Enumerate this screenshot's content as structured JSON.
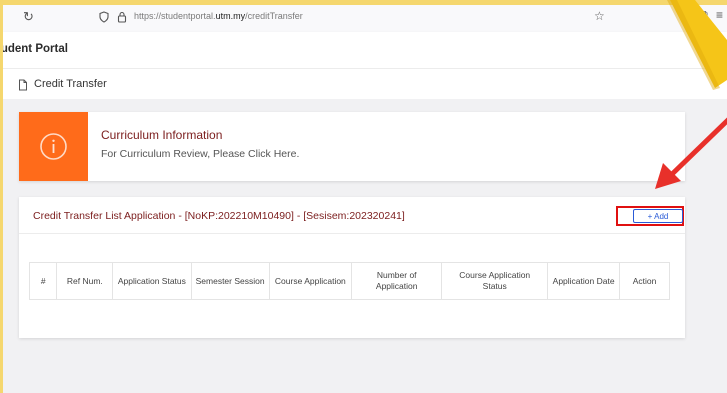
{
  "browser": {
    "url_prefix": "https://studentportal.",
    "url_host": "utm.my",
    "url_path": "/creditTransfer",
    "icons": [
      "reload-icon",
      "shield-icon",
      "lock-icon",
      "star-icon",
      "extensions-icon",
      "menu-icon"
    ]
  },
  "app": {
    "title": "tudent Portal"
  },
  "page": {
    "title": "Credit Transfer"
  },
  "info_card": {
    "title": "Curriculum Information",
    "text": "For Curriculum Review, Please Click Here."
  },
  "list": {
    "title": "Credit Transfer List Application - [NoKP:202210M10490] - [Sesisem:202320241]",
    "add_label": "+ Add",
    "columns": [
      "#",
      "Ref Num.",
      "Application Status",
      "Semester Session",
      "Course Application",
      "Number of Application",
      "Course Application Status",
      "Application Date",
      "Action"
    ],
    "rows": []
  },
  "colors": {
    "accent_orange": "#ff6b1a",
    "title_maroon": "#7b1d1d",
    "add_blue": "#2a5bd7",
    "annotation_red": "#e01010",
    "tape_yellow": "#f5c518"
  }
}
